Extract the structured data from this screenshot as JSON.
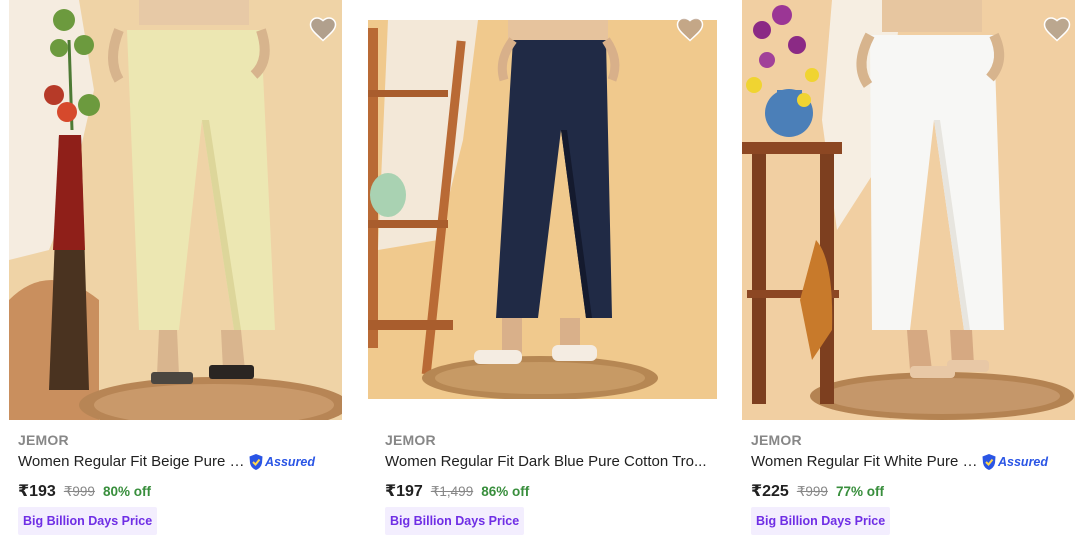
{
  "products": [
    {
      "brand": "JEMOR",
      "title": "Women Regular Fit Beige Pure C...",
      "assured": true,
      "assured_label": "Assured",
      "price": "₹193",
      "mrp": "₹999",
      "discount": "80% off",
      "badge": "Big Billion Days Price",
      "pant_color": "#ece7b2",
      "bg_color": "#f1d7ad",
      "wishlist_icon": "heart-icon"
    },
    {
      "brand": "JEMOR",
      "title": "Women Regular Fit Dark Blue Pure Cotton Tro...",
      "assured": false,
      "price": "₹197",
      "mrp": "₹1,499",
      "discount": "86% off",
      "badge": "Big Billion Days Price",
      "pant_color": "#202a45",
      "bg_color": "#f0c98d",
      "wishlist_icon": "heart-icon"
    },
    {
      "brand": "JEMOR",
      "title": "Women Regular Fit White Pure C...",
      "assured": true,
      "assured_label": "Assured",
      "price": "₹225",
      "mrp": "₹999",
      "discount": "77% off",
      "badge": "Big Billion Days Price",
      "pant_color": "#f7f7f5",
      "bg_color": "#f1cfa2",
      "wishlist_icon": "heart-icon"
    }
  ],
  "colors": {
    "brand_text": "#878787",
    "discount_green": "#388e3c",
    "badge_bg": "#f3eefe",
    "badge_text": "#6f2ee5",
    "assured_blue": "#2a55e5"
  }
}
